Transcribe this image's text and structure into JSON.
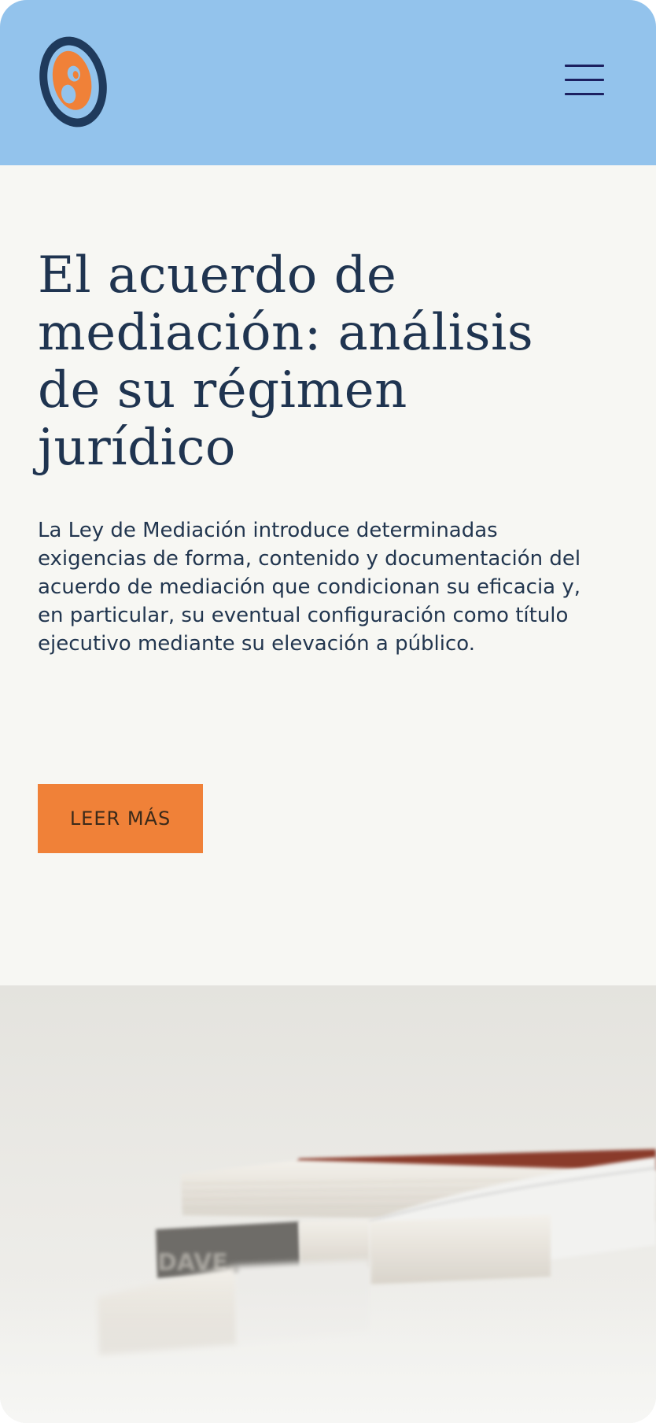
{
  "header": {
    "logo_icon": "orange-oval-logo-icon",
    "menu_icon": "hamburger-menu-icon",
    "background_color": "#93c3ec"
  },
  "hero": {
    "title": "El acuerdo de mediación: análisis de su régimen jurídico",
    "description": "La Ley de Mediación introduce determinadas exigencias de forma, contenido y documentación del acuerdo de mediación que condicionan su eficacia y, en particular, su eventual configuración como título ejecutivo mediante su elevación a público.",
    "cta_label": "LEER MÁS",
    "cta_color": "#f08138"
  },
  "photo": {
    "subject": "stack-of-books-image",
    "spine_text": "DAVE"
  },
  "colors": {
    "accent": "#f08138",
    "navy": "#1f3450",
    "background": "#f7f7f3"
  }
}
